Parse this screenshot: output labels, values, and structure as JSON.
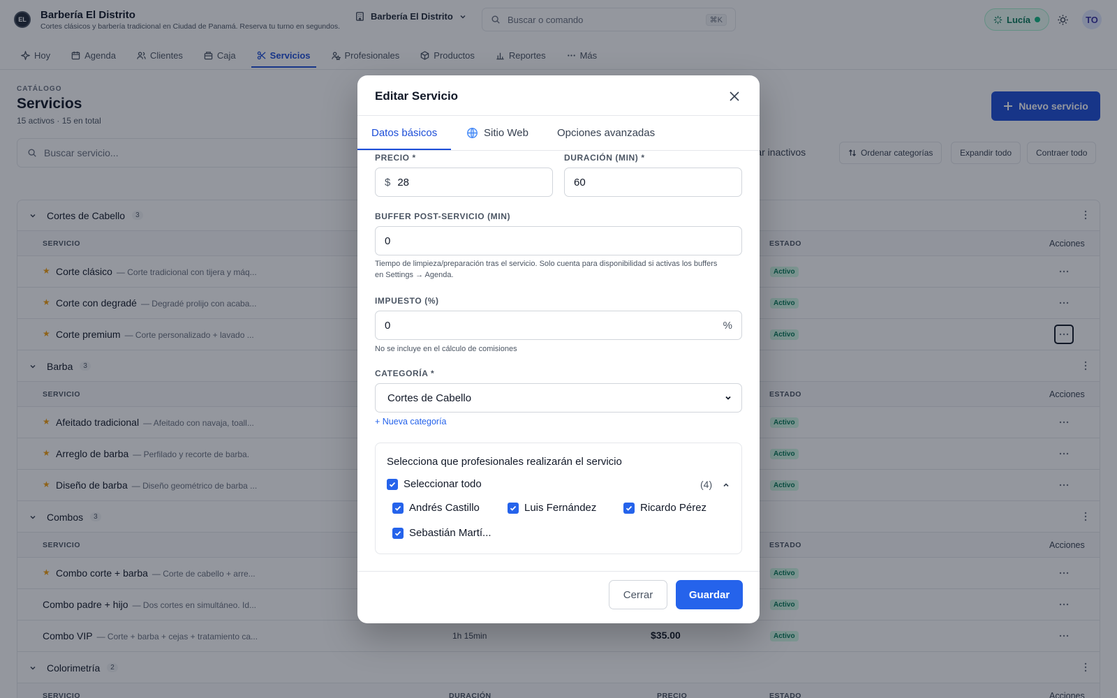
{
  "header": {
    "logo_text": "EL",
    "title": "Barbería El Distrito",
    "subtitle": "Cortes clásicos y barbería tradicional en Ciudad de Panamá. Reserva tu turno en segundos.",
    "business_selector": "Barbería El Distrito",
    "search_placeholder": "Buscar o comando",
    "search_shortcut": "⌘K",
    "user_name": "Lucía",
    "avatar_initials": "TO"
  },
  "nav": [
    {
      "label": "Hoy",
      "icon": "sparkle-icon"
    },
    {
      "label": "Agenda",
      "icon": "calendar-icon"
    },
    {
      "label": "Clientes",
      "icon": "users-icon"
    },
    {
      "label": "Caja",
      "icon": "cash-register-icon"
    },
    {
      "label": "Servicios",
      "icon": "scissors-icon",
      "active": true
    },
    {
      "label": "Profesionales",
      "icon": "professionals-icon"
    },
    {
      "label": "Productos",
      "icon": "box-icon"
    },
    {
      "label": "Reportes",
      "icon": "bar-chart-icon"
    },
    {
      "label": "Más",
      "icon": "more-icon"
    }
  ],
  "page": {
    "eyebrow": "CATÁLOGO",
    "title": "Servicios",
    "subtitle": "15 activos · 15 en total",
    "new_button": "Nuevo servicio",
    "search_placeholder": "Buscar servicio...",
    "show_inactive": "ostrar inactivos",
    "sort_categories": "Ordenar categorías",
    "expand_all": "Expandir todo",
    "collapse_all": "Contraer todo"
  },
  "columns": {
    "service": "SERVICIO",
    "duration": "DURACIÓN",
    "price": "PRECIO",
    "status": "ESTADO",
    "actions": "Acciones"
  },
  "categories": [
    {
      "name": "Cortes de Cabello",
      "count": "3",
      "services": [
        {
          "name": "Corte clásico",
          "desc": "— Corte tradicional con tijera y máq...",
          "starred": true,
          "status": "Activo"
        },
        {
          "name": "Corte con degradé",
          "desc": "— Degradé prolijo con acaba...",
          "starred": true,
          "status": "Activo"
        },
        {
          "name": "Corte premium",
          "desc": "— Corte personalizado + lavado ...",
          "starred": true,
          "status": "Activo",
          "focused": true
        }
      ]
    },
    {
      "name": "Barba",
      "count": "3",
      "services": [
        {
          "name": "Afeitado tradicional",
          "desc": "— Afeitado con navaja, toall...",
          "starred": true,
          "status": "Activo"
        },
        {
          "name": "Arreglo de barba",
          "desc": "— Perfilado y recorte de barba.",
          "starred": true,
          "status": "Activo"
        },
        {
          "name": "Diseño de barba",
          "desc": "— Diseño geométrico de barba ...",
          "starred": true,
          "status": "Activo"
        }
      ]
    },
    {
      "name": "Combos",
      "count": "3",
      "services": [
        {
          "name": "Combo corte + barba",
          "desc": "— Corte de cabello + arre...",
          "starred": true,
          "status": "Activo"
        },
        {
          "name": "Combo padre + hijo",
          "desc": "— Dos cortes en simultáneo. Id...",
          "starred": false,
          "status": "Activo"
        },
        {
          "name": "Combo VIP",
          "desc": "— Corte + barba + cejas + tratamiento ca...",
          "starred": false,
          "status": "Activo",
          "duration": "1h 15min",
          "price": "$35.00"
        }
      ]
    },
    {
      "name": "Colorimetría",
      "count": "2",
      "services": []
    }
  ],
  "modal": {
    "title": "Editar Servicio",
    "tabs": [
      {
        "label": "Datos básicos",
        "active": true
      },
      {
        "label": "Sitio Web",
        "icon": "globe-icon"
      },
      {
        "label": "Opciones avanzadas"
      }
    ],
    "price_label": "PRECIO *",
    "price_prefix": "$",
    "price_value": "28",
    "duration_label": "DURACIÓN (MIN) *",
    "duration_value": "60",
    "buffer_label": "BUFFER POST-SERVICIO (MIN)",
    "buffer_value": "0",
    "buffer_hint_1": "Tiempo de limpieza/preparación tras el servicio. Solo cuenta para disponibilidad si activas los buffers",
    "buffer_hint_2": "en Settings → Agenda.",
    "tax_label": "IMPUESTO (%)",
    "tax_value": "0",
    "tax_suffix": "%",
    "tax_hint": "No se incluye en el cálculo de comisiones",
    "category_label": "CATEGORÍA *",
    "category_value": "Cortes de Cabello",
    "new_category": "+ Nueva categoría",
    "professionals_title": "Selecciona que profesionales realizarán el servicio",
    "select_all": "Seleccionar todo",
    "selected_count": "(4)",
    "professionals": [
      "Andrés Castillo",
      "Luis Fernández",
      "Ricardo Pérez",
      "Sebastián Martí..."
    ],
    "close_button": "Cerrar",
    "save_button": "Guardar"
  },
  "colors": {
    "accent": "#2563eb",
    "nav_active": "#1d4ed8",
    "success": "#047857",
    "star": "#f59e0b"
  }
}
